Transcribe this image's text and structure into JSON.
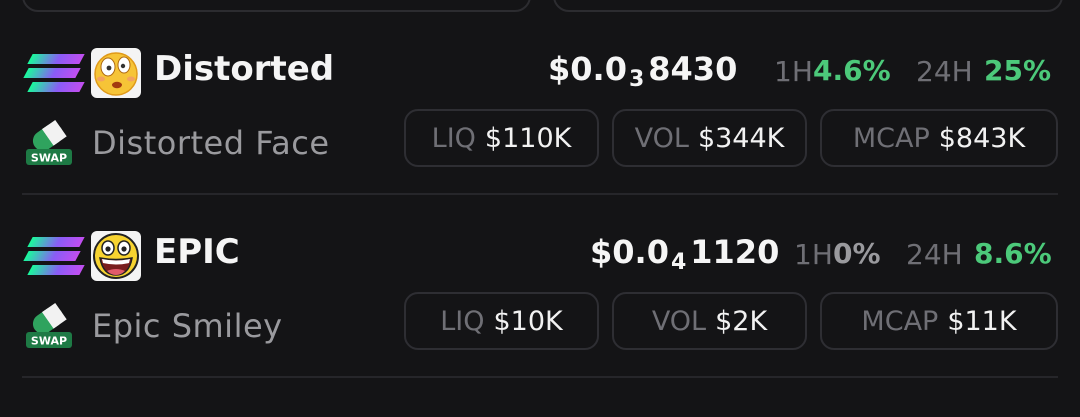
{
  "tokens": [
    {
      "symbol": "Distorted",
      "name": "Distorted Face",
      "price_prefix": "$0.0",
      "price_zeros": "3",
      "price_digits": "8430",
      "h1_label": "1H",
      "h1_change": "4.6%",
      "h1_color": "#4cc97a",
      "h24_label": "24H",
      "h24_change": "25%",
      "h24_color": "#4cc97a",
      "liq_label": "LIQ",
      "liq_value": "$110K",
      "vol_label": "VOL",
      "vol_value": "$344K",
      "mcap_label": "MCAP",
      "mcap_value": "$843K",
      "emoji": "distorted-face-emoji-icon"
    },
    {
      "symbol": "EPIC",
      "name": "Epic Smiley",
      "price_prefix": "$0.0",
      "price_zeros": "4",
      "price_digits": "1120",
      "h1_label": "1H",
      "h1_change": "0%",
      "h1_color": "#9a9a9e",
      "h24_label": "24H",
      "h24_change": "8.6%",
      "h24_color": "#4cc97a",
      "liq_label": "LIQ",
      "liq_value": "$10K",
      "vol_label": "VOL",
      "vol_value": "$2K",
      "mcap_label": "MCAP",
      "mcap_value": "$11K",
      "emoji": "epic-smiley-emoji-icon"
    }
  ],
  "icons": {
    "chain": "solana-icon",
    "swap": "swap-icon",
    "swap_text": "SWAP"
  },
  "colors": {
    "positive": "#4cc97a",
    "neutral": "#9a9a9e",
    "muted": "#6f6f75",
    "background": "#141416",
    "border": "#2e2e33"
  }
}
